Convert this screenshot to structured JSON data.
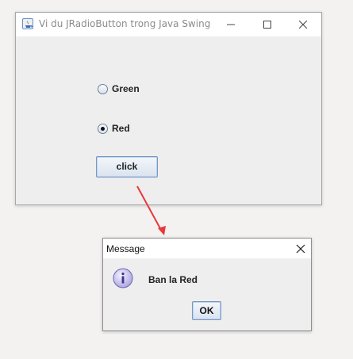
{
  "main_window": {
    "title": "Vi du JRadioButton trong Java Swing",
    "radio_options": [
      {
        "label": "Green",
        "selected": false
      },
      {
        "label": "Red",
        "selected": true
      }
    ],
    "button_label": "click"
  },
  "dialog": {
    "title": "Message",
    "message": "Ban la Red",
    "ok_label": "OK",
    "icon": "information-icon"
  },
  "annotation": {
    "arrow_color": "#e8383b"
  }
}
